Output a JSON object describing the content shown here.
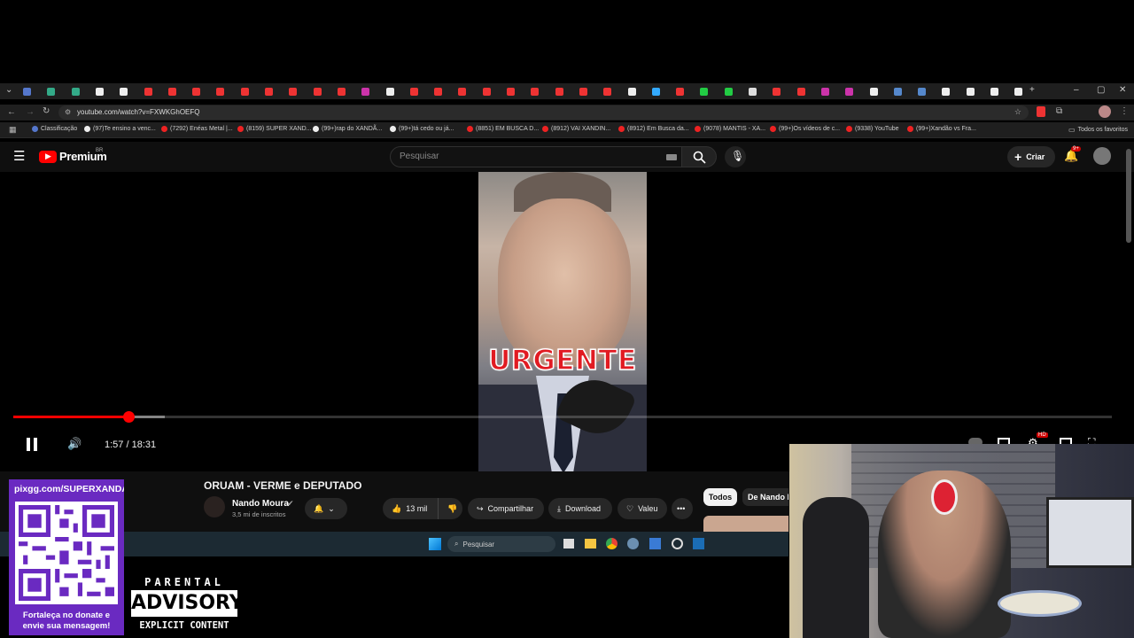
{
  "browser": {
    "url": "youtube.com/watch?v=FXWKGhOEFQ",
    "bookmarks": [
      "Classificação",
      "(97)Te ensino a venc...",
      "(7292) Enéas Metal |...",
      "(8159) SUPER XAND...",
      "(99+)rap do XANDÃ...",
      "(99+)tá cedo ou já...",
      "(8851) EM BUSCA D...",
      "(8912) VAI XANDIN...",
      "(8912) Em Busca da...",
      "(9078) MANTIS - XA...",
      "(99+)Os vídeos de c...",
      "(9338) YouTube",
      "(99+)Xandão vs Fra...",
      "Todos os favoritos"
    ]
  },
  "youtube": {
    "logo_text": "Premium",
    "region": "BR",
    "search_placeholder": "Pesquisar",
    "create_label": "Criar",
    "notif_count": "9+"
  },
  "player": {
    "overlay_text": "URGENTE",
    "time": "1:57 / 18:31",
    "progress_fraction": 0.105,
    "buffer_fraction": 0.138,
    "hd_badge": "HD"
  },
  "video": {
    "title": "ORUAM - VERME e DEPUTADO",
    "channel": "Nando Moura",
    "subscribers": "3,5 mi de inscritos",
    "likes": "13 mil",
    "share": "Compartilhar",
    "download": "Download",
    "thanks": "Valeu",
    "chip_all": "Todos",
    "chip_channel": "De Nando M"
  },
  "taskbar": {
    "search": "Pesquisar"
  },
  "overlay": {
    "donate_url": "pixgg.com/SUPERXANDAO",
    "donate_msg_1": "Fortaleça no donate e",
    "donate_msg_2": "envie sua mensagem!",
    "pa_top": "PARENTAL",
    "pa_mid": "ADVISORY",
    "pa_bot": "EXPLICIT CONTENT"
  },
  "colors": {
    "accent": "#ff0000",
    "donate_bg": "#6a2ac1",
    "taskbar": "#1c2a33"
  }
}
